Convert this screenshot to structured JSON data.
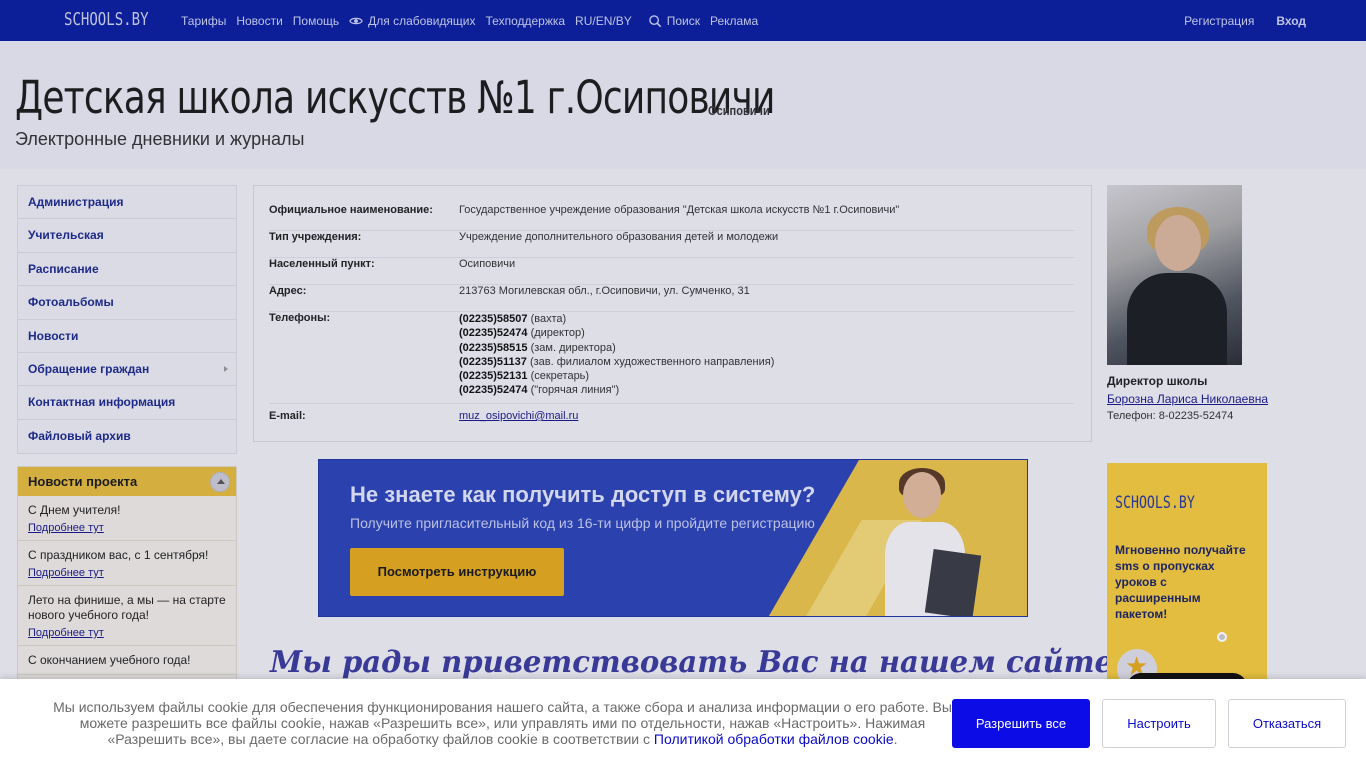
{
  "topbar": {
    "logo": "SCHOOLS.BY",
    "nav": [
      "Тарифы",
      "Новости",
      "Помощь",
      "Для слабовидящих",
      "Техподдержка",
      "RU/EN/BY",
      "Поиск",
      "Реклама"
    ],
    "register": "Регистрация",
    "login": "Вход"
  },
  "header": {
    "title": "Детская школа искусств №1 г.Осиповичи",
    "city": "Осиповичи",
    "subtitle": "Электронные дневники и журналы"
  },
  "sidebar": {
    "items": [
      "Администрация",
      "Учительская",
      "Расписание",
      "Фотоальбомы",
      "Новости",
      "Обращение граждан",
      "Контактная информация",
      "Файловый архив"
    ]
  },
  "news": {
    "title": "Новости проекта",
    "more": "Подробнее тут",
    "entries": [
      "С Днем учителя!",
      "С праздником вас, с 1 сентября!",
      "Лето на финише, а мы — на старте нового учебного года!",
      "С окончанием учебного года!"
    ]
  },
  "info": {
    "official_label": "Официальное наименование:",
    "official_value": "Государственное учреждение образования \"Детская школа искусств №1 г.Осиповичи\"",
    "type_label": "Тип учреждения:",
    "type_value": "Учреждение дополнительного образования детей и молодежи",
    "locality_label": "Населенный пункт:",
    "locality_value": "Осиповичи",
    "address_label": "Адрес:",
    "address_value": "213763 Могилевская обл., г.Осиповичи, ул. Сумченко, 31",
    "phones_label": "Телефоны:",
    "phones": [
      {
        "number": "(02235)58507",
        "note": " (вахта)"
      },
      {
        "number": "(02235)52474",
        "note": " (директор)"
      },
      {
        "number": "(02235)58515",
        "note": " (зам. директора)"
      },
      {
        "number": "(02235)51137",
        "note": " (зав. филиалом художественного направления)"
      },
      {
        "number": "(02235)52131",
        "note": " (секретарь)"
      },
      {
        "number": "(02235)52474",
        "note": " (\"горячая линия\")"
      }
    ],
    "email_label": "E-mail:",
    "email_value": "muz_osipovichi@mail.ru"
  },
  "director": {
    "role": "Директор школы",
    "name": "Борозна Лариса Николаевна",
    "phone": "Телефон: 8-02235-52474"
  },
  "banner": {
    "heading": "Не знаете как получить доступ в систему?",
    "subtext": "Получите пригласительный код из 16-ти цифр и пройдите регистрацию",
    "button": "Посмотреть инструкцию"
  },
  "welcome": "Мы рады приветствовать Вас на нашем сайте!",
  "ad": {
    "logo": "SCHOOLS.BY",
    "text": "Мгновенно получайте sms о пропусках уроков с расширенным пакетом!"
  },
  "cookie": {
    "text_before": "Мы используем файлы cookie для обеспечения функционирования нашего сайта, а также сбора и анализа информации о его работе. Вы можете разрешить все файлы cookie, нажав «Разрешить все», или управлять ими по отдельности, нажав «Настроить». Нажимая «Разрешить все», вы даете согласие на обработку файлов cookie в соответствии с ",
    "link": "Политикой обработки файлов cookie",
    "text_after": ".",
    "allow": "Разрешить все",
    "setup": "Настроить",
    "deny": "Отказаться"
  }
}
